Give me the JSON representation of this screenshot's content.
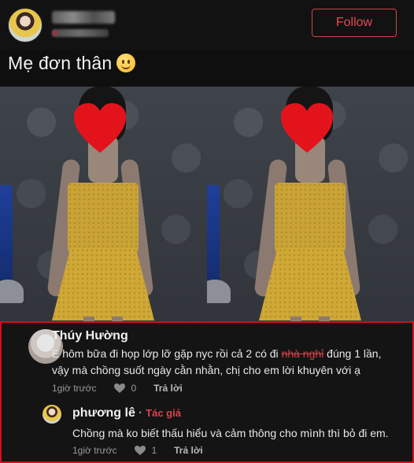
{
  "header": {
    "follow_label": "Follow"
  },
  "post": {
    "title": "Mẹ đơn thân"
  },
  "comment": {
    "author": "Thúy Hường",
    "text_before": "E hôm bữa đi họp lớp lỡ gặp nyc rồi cả 2 có đi ",
    "text_struck": "nhà nghỉ",
    "text_after": " đúng 1 lần, vậy mà chồng suốt ngày cằn nhằn, chị cho em lời khuyên với ạ",
    "time": "1giờ trước",
    "likes": "0",
    "reply_label": "Trả lời"
  },
  "reply": {
    "author": "phương lê",
    "author_tag": "Tác giả",
    "text": "Chồng mà ko biết thấu hiểu và cảm thông cho mình thì bỏ đi em.",
    "time": "1giờ trước",
    "likes": "1",
    "reply_label": "Trả lời"
  },
  "colors": {
    "accent": "#d6404b",
    "highlight_border": "#c9131f",
    "background": "#0f0f0f"
  }
}
